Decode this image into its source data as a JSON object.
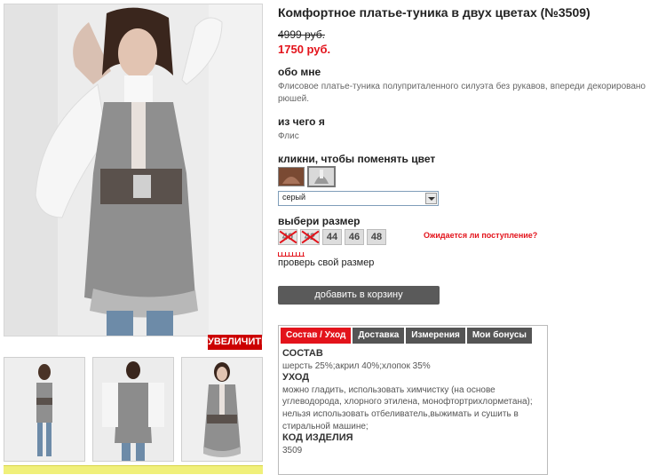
{
  "product": {
    "title": "Комфортное платье-туника в двух цветах (№3509)",
    "old_price": "4999 руб.",
    "new_price": "1750 руб."
  },
  "about": {
    "heading": "обо мне",
    "text": "Флисовое платье-туника полуприталенного силуэта без рукавов, впереди декорировано рюшей."
  },
  "material": {
    "heading": "из чего я",
    "text": "Флис"
  },
  "color": {
    "heading": "кликни, чтобы поменять цвет",
    "swatches": [
      {
        "name": "brown",
        "color": "#7a4a33"
      },
      {
        "name": "grey",
        "color": "#9a9a9a"
      }
    ],
    "selected": "серый"
  },
  "size": {
    "heading": "выбери размер",
    "options": [
      {
        "label": "40",
        "available": false
      },
      {
        "label": "42",
        "available": false
      },
      {
        "label": "44",
        "available": true
      },
      {
        "label": "46",
        "available": true
      },
      {
        "label": "48",
        "available": true
      }
    ],
    "notify_link": "Ожидается ли поступление?",
    "check_size": "проверь свой размер"
  },
  "cart_button": "добавить в корзину",
  "gallery": {
    "zoom_label": "УВЕЛИЧИТЬ"
  },
  "tabs": {
    "items": [
      "Состав / Уход",
      "Доставка",
      "Измерения",
      "Мои бонусы"
    ],
    "active": 0,
    "content": {
      "composition_h": "СОСТАВ",
      "composition": "шерсть 25%;акрил 40%;хлопок 35%",
      "care_h": "УХОД",
      "care": "можно гладить, использовать химчистку (на основе углеводорода, хлорного этилена, монофтортрихлорметана); нельзя использовать отбеливатель,выжимать и сушить в стиральной машине;",
      "code_h": "КОД ИЗДЕЛИЯ",
      "code": "3509"
    }
  },
  "colors": {
    "accent": "#e3131b",
    "button": "#5a5a5a",
    "tab": "#555555"
  }
}
